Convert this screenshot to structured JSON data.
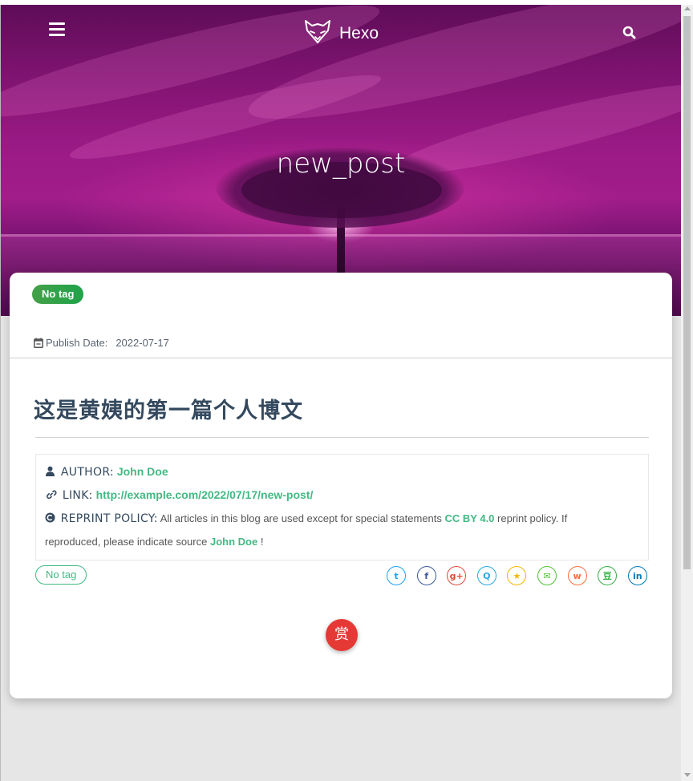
{
  "header": {
    "brand": "Hexo",
    "logo_icon": "fox-logo-icon",
    "menu_icon": "hamburger-menu-icon",
    "search_icon": "search-icon"
  },
  "hero": {
    "title": "new_post"
  },
  "post": {
    "tag_chip": "No tag",
    "publish_label": "Publish Date:",
    "publish_date": "2022-07-17",
    "title": "这是黄姨的第一篇个人博文",
    "author_label": "AUTHOR:",
    "author_name": "John Doe",
    "link_label": "LINK:",
    "link_url": "http://example.com/2022/07/17/new-post/",
    "reprint_label": "REPRINT POLICY:",
    "reprint_text_1": "All articles in this blog are used except for special statements",
    "reprint_license": "CC BY 4.0",
    "reprint_text_2": "reprint policy. If",
    "reprint_text_3": "reproduced, please indicate source",
    "reprint_source": "John Doe",
    "reprint_text_4": "!",
    "tag_outline": "No tag",
    "reward_label": "赏"
  },
  "share": [
    {
      "name": "twitter-icon",
      "glyph": "t",
      "color": "#1da1f2"
    },
    {
      "name": "facebook-icon",
      "glyph": "f",
      "color": "#3b5998"
    },
    {
      "name": "google-plus-icon",
      "glyph": "g+",
      "color": "#dd4b39"
    },
    {
      "name": "qq-icon",
      "glyph": "Q",
      "color": "#2aa7e0"
    },
    {
      "name": "qzone-icon",
      "glyph": "★",
      "color": "#f2b600"
    },
    {
      "name": "wechat-icon",
      "glyph": "✉",
      "color": "#4fc332"
    },
    {
      "name": "weibo-icon",
      "glyph": "w",
      "color": "#ff6d3e"
    },
    {
      "name": "douban-icon",
      "glyph": "豆",
      "color": "#33b045"
    },
    {
      "name": "linkedin-icon",
      "glyph": "in",
      "color": "#0077b5"
    }
  ],
  "colors": {
    "accent": "#42b983",
    "chip": "#3aa845",
    "reward": "#e53935"
  }
}
